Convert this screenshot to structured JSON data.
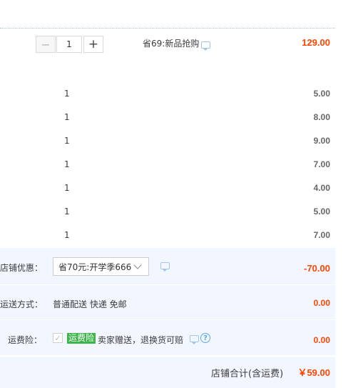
{
  "item": {
    "minus_label": "−",
    "quantity": "1",
    "plus_label": "+",
    "promo": "省69:新品抢购",
    "price": "129.00"
  },
  "gifts": [
    {
      "qty": "1",
      "price": "5.00"
    },
    {
      "qty": "1",
      "price": "8.00"
    },
    {
      "qty": "1",
      "price": "9.00"
    },
    {
      "qty": "1",
      "price": "7.00"
    },
    {
      "qty": "1",
      "price": "4.00"
    },
    {
      "qty": "1",
      "price": "5.00"
    },
    {
      "qty": "1",
      "price": "7.00"
    }
  ],
  "shop_discount": {
    "label": "店铺优惠：",
    "selected": "省70元:开学季666",
    "amount": "-70.00"
  },
  "shipping": {
    "label": "运送方式：",
    "value": "普通配送 快递 免邮",
    "amount": "0.00"
  },
  "insurance": {
    "label": "运费险：",
    "tag": "运费险",
    "text": "卖家赠送，退换货可赔",
    "help": "?",
    "amount": "0.00",
    "check": "✓"
  },
  "total": {
    "label": "店铺合计(含运费)",
    "amount": "￥59.00"
  },
  "colors": {
    "price_red": "#ff4400",
    "band_bg": "#f2f7ff",
    "tag_green": "#3bb54a",
    "icon_blue": "#9fc7e8"
  }
}
